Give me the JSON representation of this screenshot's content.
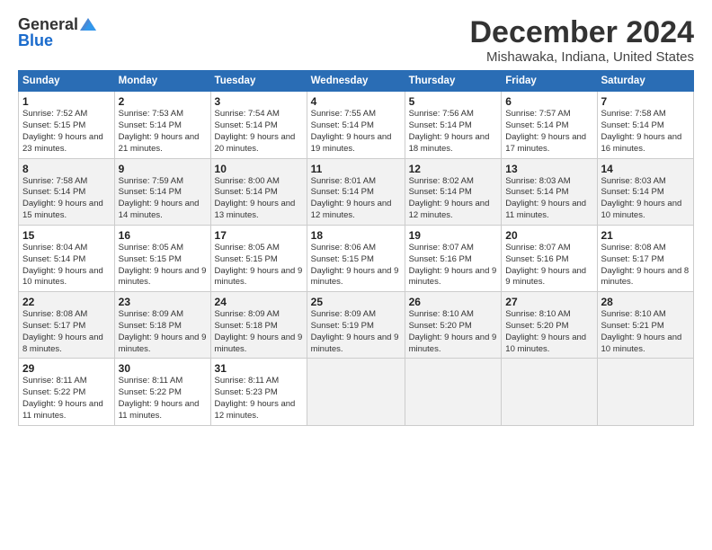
{
  "header": {
    "logo_general": "General",
    "logo_blue": "Blue",
    "title": "December 2024",
    "subtitle": "Mishawaka, Indiana, United States"
  },
  "weekdays": [
    "Sunday",
    "Monday",
    "Tuesday",
    "Wednesday",
    "Thursday",
    "Friday",
    "Saturday"
  ],
  "weeks": [
    [
      {
        "day": "1",
        "sunrise": "Sunrise: 7:52 AM",
        "sunset": "Sunset: 5:15 PM",
        "daylight": "Daylight: 9 hours and 23 minutes."
      },
      {
        "day": "2",
        "sunrise": "Sunrise: 7:53 AM",
        "sunset": "Sunset: 5:14 PM",
        "daylight": "Daylight: 9 hours and 21 minutes."
      },
      {
        "day": "3",
        "sunrise": "Sunrise: 7:54 AM",
        "sunset": "Sunset: 5:14 PM",
        "daylight": "Daylight: 9 hours and 20 minutes."
      },
      {
        "day": "4",
        "sunrise": "Sunrise: 7:55 AM",
        "sunset": "Sunset: 5:14 PM",
        "daylight": "Daylight: 9 hours and 19 minutes."
      },
      {
        "day": "5",
        "sunrise": "Sunrise: 7:56 AM",
        "sunset": "Sunset: 5:14 PM",
        "daylight": "Daylight: 9 hours and 18 minutes."
      },
      {
        "day": "6",
        "sunrise": "Sunrise: 7:57 AM",
        "sunset": "Sunset: 5:14 PM",
        "daylight": "Daylight: 9 hours and 17 minutes."
      },
      {
        "day": "7",
        "sunrise": "Sunrise: 7:58 AM",
        "sunset": "Sunset: 5:14 PM",
        "daylight": "Daylight: 9 hours and 16 minutes."
      }
    ],
    [
      {
        "day": "8",
        "sunrise": "Sunrise: 7:58 AM",
        "sunset": "Sunset: 5:14 PM",
        "daylight": "Daylight: 9 hours and 15 minutes."
      },
      {
        "day": "9",
        "sunrise": "Sunrise: 7:59 AM",
        "sunset": "Sunset: 5:14 PM",
        "daylight": "Daylight: 9 hours and 14 minutes."
      },
      {
        "day": "10",
        "sunrise": "Sunrise: 8:00 AM",
        "sunset": "Sunset: 5:14 PM",
        "daylight": "Daylight: 9 hours and 13 minutes."
      },
      {
        "day": "11",
        "sunrise": "Sunrise: 8:01 AM",
        "sunset": "Sunset: 5:14 PM",
        "daylight": "Daylight: 9 hours and 12 minutes."
      },
      {
        "day": "12",
        "sunrise": "Sunrise: 8:02 AM",
        "sunset": "Sunset: 5:14 PM",
        "daylight": "Daylight: 9 hours and 12 minutes."
      },
      {
        "day": "13",
        "sunrise": "Sunrise: 8:03 AM",
        "sunset": "Sunset: 5:14 PM",
        "daylight": "Daylight: 9 hours and 11 minutes."
      },
      {
        "day": "14",
        "sunrise": "Sunrise: 8:03 AM",
        "sunset": "Sunset: 5:14 PM",
        "daylight": "Daylight: 9 hours and 10 minutes."
      }
    ],
    [
      {
        "day": "15",
        "sunrise": "Sunrise: 8:04 AM",
        "sunset": "Sunset: 5:14 PM",
        "daylight": "Daylight: 9 hours and 10 minutes."
      },
      {
        "day": "16",
        "sunrise": "Sunrise: 8:05 AM",
        "sunset": "Sunset: 5:15 PM",
        "daylight": "Daylight: 9 hours and 9 minutes."
      },
      {
        "day": "17",
        "sunrise": "Sunrise: 8:05 AM",
        "sunset": "Sunset: 5:15 PM",
        "daylight": "Daylight: 9 hours and 9 minutes."
      },
      {
        "day": "18",
        "sunrise": "Sunrise: 8:06 AM",
        "sunset": "Sunset: 5:15 PM",
        "daylight": "Daylight: 9 hours and 9 minutes."
      },
      {
        "day": "19",
        "sunrise": "Sunrise: 8:07 AM",
        "sunset": "Sunset: 5:16 PM",
        "daylight": "Daylight: 9 hours and 9 minutes."
      },
      {
        "day": "20",
        "sunrise": "Sunrise: 8:07 AM",
        "sunset": "Sunset: 5:16 PM",
        "daylight": "Daylight: 9 hours and 9 minutes."
      },
      {
        "day": "21",
        "sunrise": "Sunrise: 8:08 AM",
        "sunset": "Sunset: 5:17 PM",
        "daylight": "Daylight: 9 hours and 8 minutes."
      }
    ],
    [
      {
        "day": "22",
        "sunrise": "Sunrise: 8:08 AM",
        "sunset": "Sunset: 5:17 PM",
        "daylight": "Daylight: 9 hours and 8 minutes."
      },
      {
        "day": "23",
        "sunrise": "Sunrise: 8:09 AM",
        "sunset": "Sunset: 5:18 PM",
        "daylight": "Daylight: 9 hours and 9 minutes."
      },
      {
        "day": "24",
        "sunrise": "Sunrise: 8:09 AM",
        "sunset": "Sunset: 5:18 PM",
        "daylight": "Daylight: 9 hours and 9 minutes."
      },
      {
        "day": "25",
        "sunrise": "Sunrise: 8:09 AM",
        "sunset": "Sunset: 5:19 PM",
        "daylight": "Daylight: 9 hours and 9 minutes."
      },
      {
        "day": "26",
        "sunrise": "Sunrise: 8:10 AM",
        "sunset": "Sunset: 5:20 PM",
        "daylight": "Daylight: 9 hours and 9 minutes."
      },
      {
        "day": "27",
        "sunrise": "Sunrise: 8:10 AM",
        "sunset": "Sunset: 5:20 PM",
        "daylight": "Daylight: 9 hours and 10 minutes."
      },
      {
        "day": "28",
        "sunrise": "Sunrise: 8:10 AM",
        "sunset": "Sunset: 5:21 PM",
        "daylight": "Daylight: 9 hours and 10 minutes."
      }
    ],
    [
      {
        "day": "29",
        "sunrise": "Sunrise: 8:11 AM",
        "sunset": "Sunset: 5:22 PM",
        "daylight": "Daylight: 9 hours and 11 minutes."
      },
      {
        "day": "30",
        "sunrise": "Sunrise: 8:11 AM",
        "sunset": "Sunset: 5:22 PM",
        "daylight": "Daylight: 9 hours and 11 minutes."
      },
      {
        "day": "31",
        "sunrise": "Sunrise: 8:11 AM",
        "sunset": "Sunset: 5:23 PM",
        "daylight": "Daylight: 9 hours and 12 minutes."
      },
      null,
      null,
      null,
      null
    ]
  ]
}
